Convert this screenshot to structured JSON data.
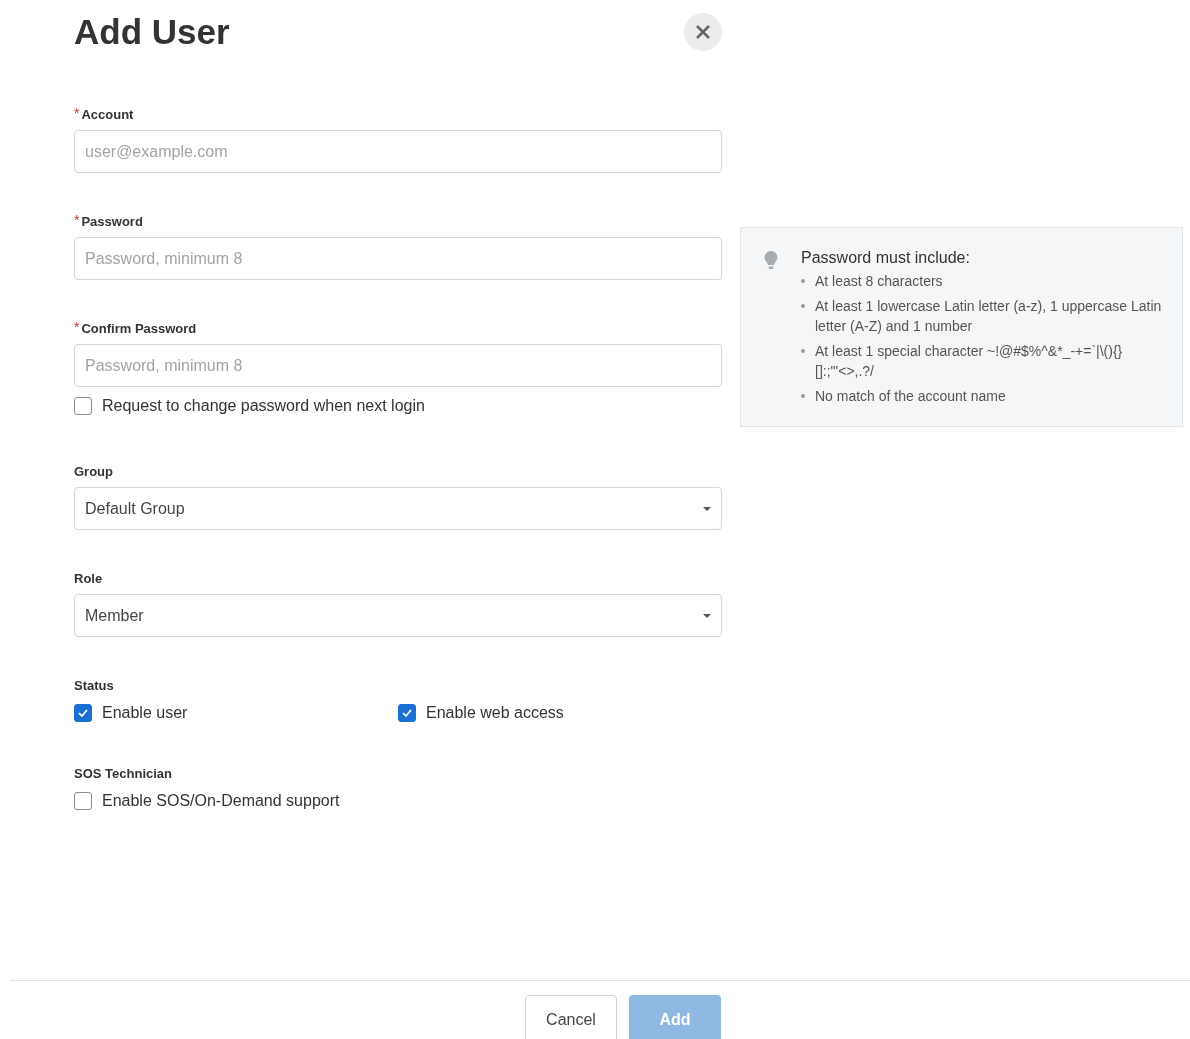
{
  "title": "Add User",
  "fields": [
    {
      "kind": "text",
      "label": "Account",
      "required_mark": "*",
      "placeholder": "user@example.com"
    },
    {
      "kind": "text",
      "label": "Password",
      "required_mark": "*",
      "placeholder": "Password, minimum 8"
    },
    {
      "kind": "text",
      "label": "Confirm Password",
      "required_mark": "*",
      "placeholder": "Password, minimum 8",
      "checkbox": {
        "label": "Request to change password when next login",
        "checked": false
      }
    },
    {
      "kind": "select",
      "label": "Group",
      "value": "Default Group"
    },
    {
      "kind": "select",
      "label": "Role",
      "value": "Member"
    },
    {
      "kind": "checks",
      "label": "Status",
      "options": [
        {
          "label": "Enable user",
          "checked": true
        },
        {
          "label": "Enable web access",
          "checked": true
        }
      ]
    },
    {
      "kind": "checks",
      "label": "SOS Technician",
      "options": [
        {
          "label": "Enable SOS/On-Demand support",
          "checked": false
        }
      ]
    }
  ],
  "hint": {
    "title": "Password must include:",
    "items": [
      "At least 8 characters",
      "At least 1 lowercase Latin letter (a-z), 1 uppercase Latin letter (A-Z) and 1 number",
      "At least 1 special character ~!@#$%^&*_-+=`|\\(){}[]:;\"'<>,.?/",
      "No match of the account name"
    ]
  },
  "buttons": [
    {
      "label": "Cancel",
      "kind": "secondary",
      "disabled": false
    },
    {
      "label": "Add",
      "kind": "primary",
      "disabled": true
    }
  ]
}
